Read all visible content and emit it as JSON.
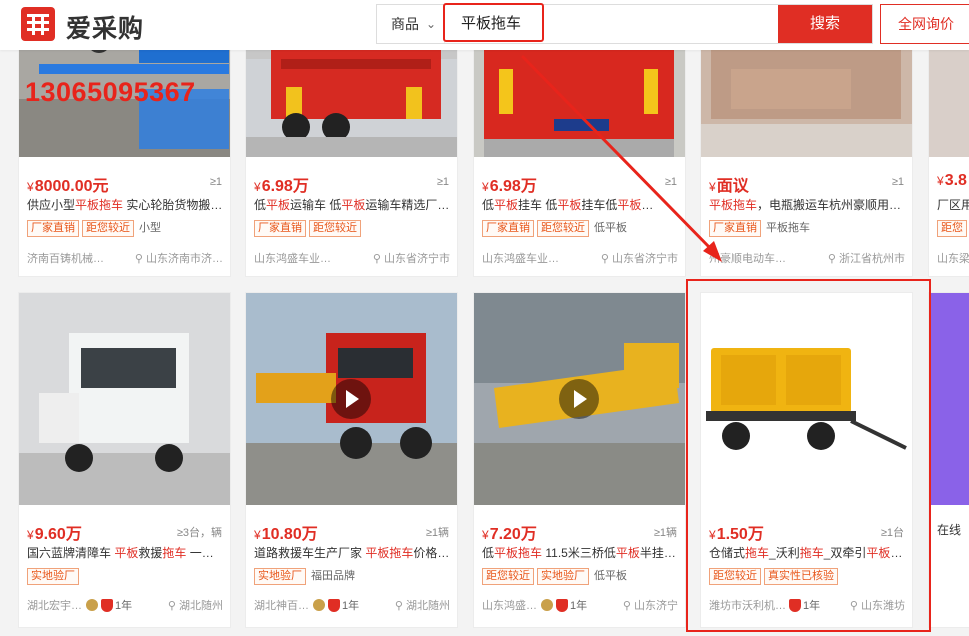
{
  "header": {
    "logo_text": "爱采购",
    "search_scope": "商品",
    "search_query": "平板拖车",
    "search_button": "搜索",
    "inquiry_button": "全网询价"
  },
  "watermark_phone": "13065095367",
  "row1": [
    {
      "currency": "¥",
      "price": "8000.00元",
      "moq": "≥1",
      "title_html": "供应小型<em>平板拖车</em> 实心轮胎货物搬…",
      "tags": [
        "厂家直销",
        "距您较近"
      ],
      "plain_tags": [
        "小型"
      ],
      "shop": "济南百铸机械…",
      "location": "山东济南市济…"
    },
    {
      "currency": "¥",
      "price": "6.98万",
      "moq": "≥1",
      "title_html": "低<em>平板</em>运输车 低<em>平板</em>运输车精选厂…",
      "tags": [
        "厂家直销",
        "距您较近"
      ],
      "plain_tags": [],
      "shop": "山东鸿盛车业有…",
      "location": "山东省济宁市"
    },
    {
      "currency": "¥",
      "price": "6.98万",
      "moq": "≥1",
      "title_html": "低<em>平板</em>挂车 低<em>平板</em>挂车低<em>平板</em>…",
      "tags": [
        "厂家直销",
        "距您较近"
      ],
      "plain_tags": [
        "低平板"
      ],
      "shop": "山东鸿盛车业有…",
      "location": "山东省济宁市"
    },
    {
      "currency": "¥",
      "price": "面议",
      "moq": "≥1",
      "title_html": "<em>平板拖车</em>，电瓶搬运车杭州豪顺用…",
      "tags": [
        "厂家直销"
      ],
      "plain_tags": [
        "平板拖车"
      ],
      "shop": "州豪顺电动车…",
      "location": "浙江省杭州市"
    },
    {
      "currency": "¥",
      "price": "3.8",
      "moq": "",
      "title_html": "厂区用",
      "tags": [
        "距您"
      ],
      "plain_tags": [],
      "shop": "山东梁",
      "location": ""
    }
  ],
  "row2": [
    {
      "currency": "¥",
      "price": "9.60万",
      "moq": "≥3台，辆",
      "title_html": "国六蓝牌清障车 <em>平板</em>救援<em>拖车</em> 一…",
      "tags": [
        "实地验厂"
      ],
      "plain_tags": [],
      "shop": "湖北宏宇…",
      "years": "1年",
      "location": "湖北随州"
    },
    {
      "currency": "¥",
      "price": "10.80万",
      "moq": "≥1辆",
      "title_html": "道路救援车生产厂家 <em>平板拖车</em>价格…",
      "tags": [
        "实地验厂"
      ],
      "plain_tags": [
        "福田品牌"
      ],
      "shop": "湖北神百…",
      "years": "1年",
      "location": "湖北随州"
    },
    {
      "currency": "¥",
      "price": "7.20万",
      "moq": "≥1辆",
      "title_html": "低<em>平板拖车</em> 11.5米三桥低<em>平板</em>半挂…",
      "tags": [
        "距您较近",
        "实地验厂"
      ],
      "plain_tags": [
        "低平板"
      ],
      "shop": "山东鸿盛…",
      "years": "1年",
      "location": "山东济宁"
    },
    {
      "currency": "¥",
      "price": "1.50万",
      "moq": "≥1台",
      "title_html": "仓储式<em>拖车</em>_沃利<em>拖车</em>_双牵引<em>平板</em>…",
      "tags": [
        "距您较近",
        "真实性已核验"
      ],
      "plain_tags": [],
      "shop": "潍坊市沃利机…",
      "years": "1年",
      "location": "山东潍坊"
    },
    {
      "title_html": "在线"
    }
  ],
  "colors": {
    "brand_red": "#e02e24",
    "price_red": "#e02e24",
    "annotation_red": "#e8241b"
  }
}
